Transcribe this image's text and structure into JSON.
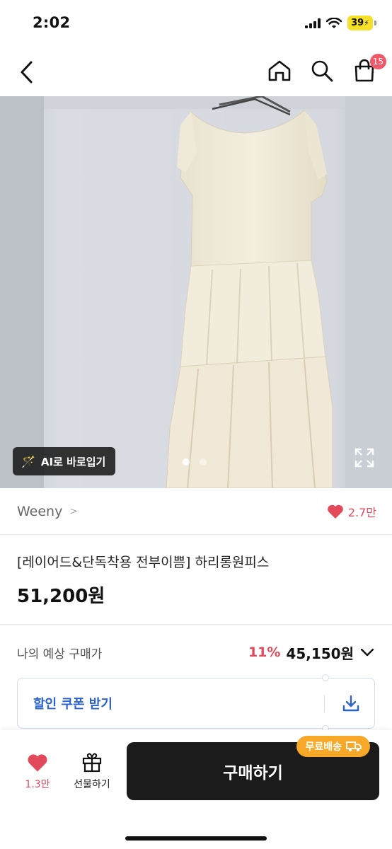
{
  "status_bar": {
    "time": "2:02",
    "battery": "39"
  },
  "nav": {
    "cart_count": "15"
  },
  "hero": {
    "ai_button_label": "AI로 바로입기",
    "image_count": 2,
    "active_index": 0
  },
  "brand": {
    "name": "Weeny",
    "chevron": ">",
    "like_count": "2.7만"
  },
  "product": {
    "title": "[레이어드&단독착용 전부이쁨] 하리롱원피스",
    "price": "51,200원"
  },
  "expected_price": {
    "label": "나의 예상 구매가",
    "discount": "11%",
    "final_price": "45,150원"
  },
  "coupon": {
    "label": "할인 쿠폰 받기"
  },
  "bottom_bar": {
    "like_count": "1.3만",
    "gift_label": "선물하기",
    "buy_label": "구매하기",
    "free_shipping_label": "무료배송"
  },
  "colors": {
    "accent_red": "#e2495b",
    "coupon_blue": "#2a62d6",
    "buy_black": "#1b1b1b",
    "free_ship_orange": "#f7a829"
  }
}
